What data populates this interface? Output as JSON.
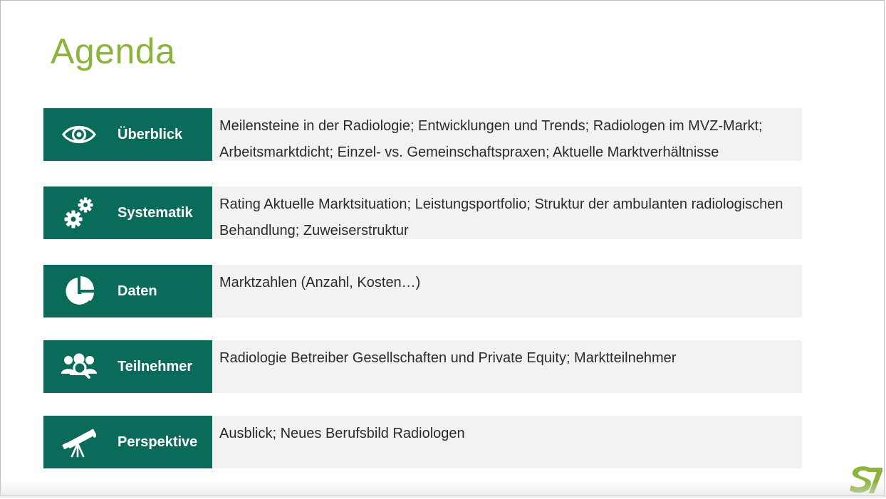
{
  "title": "Agenda",
  "colors": {
    "accent_green": "#8cb43c",
    "header_teal": "#0b6b5a",
    "row_background": "#f2f2f2"
  },
  "rows": [
    {
      "icon": "eye-icon",
      "label": "Überblick",
      "description": "Meilensteine in der Radiologie; Entwicklungen und Trends; Radiologen im MVZ-Markt; Arbeitsmarktdicht; Einzel- vs. Gemeinschaftspraxen; Aktuelle Marktverhältnisse"
    },
    {
      "icon": "gears-icon",
      "label": "Systematik",
      "description": "Rating Aktuelle Marktsituation; Leistungsportfolio; Struktur der ambulanten radiologischen Behandlung; Zuweiserstruktur"
    },
    {
      "icon": "pie-chart-icon",
      "label": "Daten",
      "description": "Marktzahlen (Anzahl, Kosten…)"
    },
    {
      "icon": "users-search-icon",
      "label": "Teilnehmer",
      "description": "Radiologie Betreiber Gesellschaften und Private Equity; Marktteilnehmer"
    },
    {
      "icon": "telescope-icon",
      "label": "Perspektive",
      "description": "Ausblick; Neues Berufsbild Radiologen"
    }
  ],
  "logo": {
    "icon": "company-logo-icon"
  }
}
